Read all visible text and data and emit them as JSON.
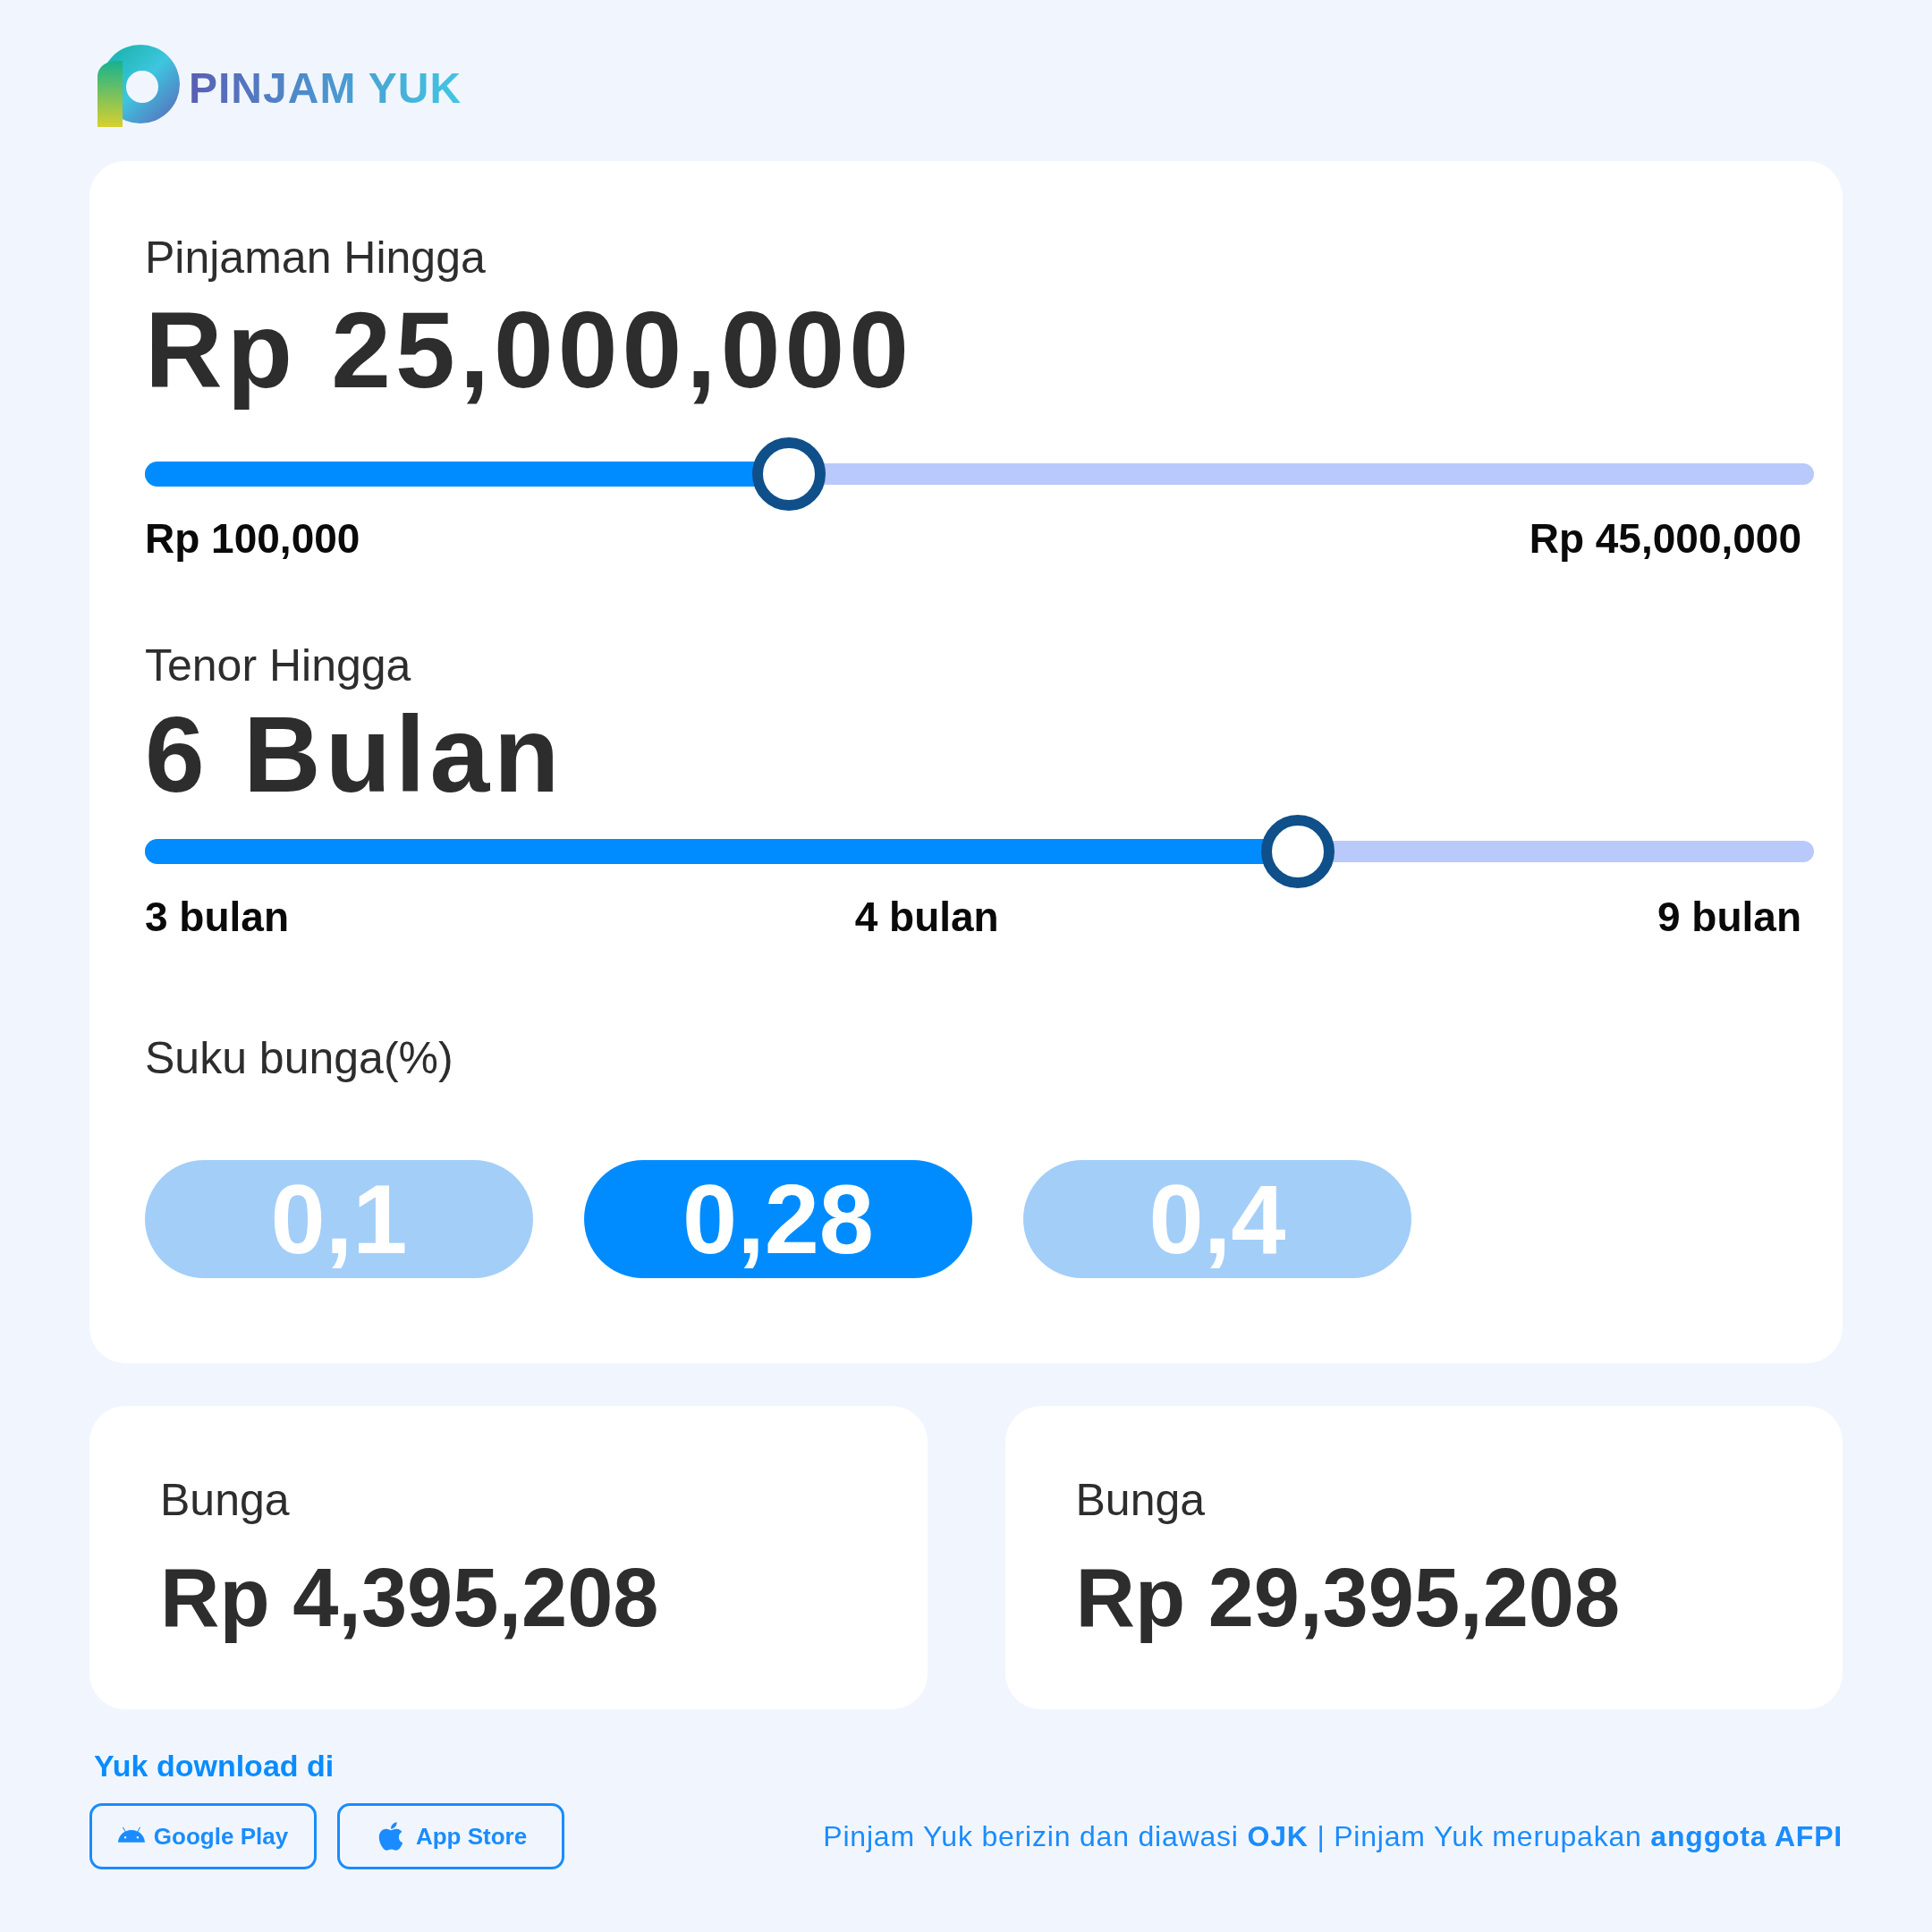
{
  "logo": {
    "text": "PINJAM YUK"
  },
  "loan": {
    "label": "Pinjaman Hingga",
    "value": "Rp 25,000,000",
    "level": 0.386,
    "range_labels": [
      "Rp 100,000",
      "Rp 45,000,000"
    ]
  },
  "tenor": {
    "label": "Tenor Hingga",
    "value": "6 Bulan",
    "level": 0.691,
    "range_labels": [
      "3 bulan",
      "4 bulan",
      "9 bulan"
    ]
  },
  "interest": {
    "label": "Suku bunga(%)",
    "options": [
      {
        "label": "0,1",
        "selected": false
      },
      {
        "label": "0,28",
        "selected": true
      },
      {
        "label": "0,4",
        "selected": false
      }
    ]
  },
  "results": [
    {
      "label": "Bunga",
      "value": "Rp 4,395,208"
    },
    {
      "label": "Bunga",
      "value": "Rp 29,395,208"
    }
  ],
  "download": {
    "label": "Yuk download di",
    "buttons": [
      {
        "kind": "android",
        "label": "Google Play"
      },
      {
        "kind": "apple",
        "label": "App Store"
      }
    ]
  },
  "footer": "Pinjam Yuk berizin dan diawasi **OJK** | Pinjam Yuk merupakan **anggota AFPI**"
}
